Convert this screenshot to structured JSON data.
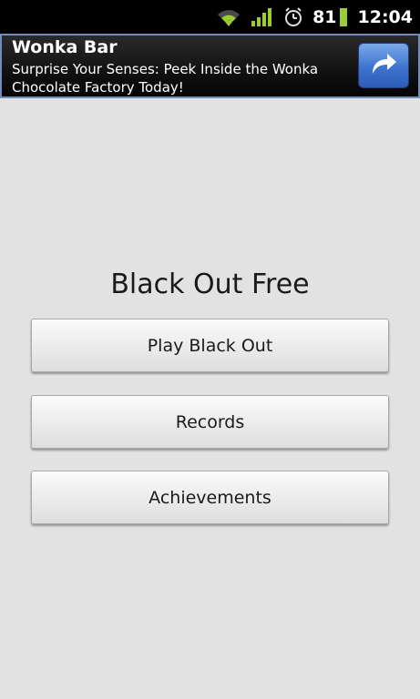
{
  "status_bar": {
    "battery": "81",
    "time": "12:04",
    "icons": [
      "wifi-icon",
      "signal-icon",
      "alarm-icon",
      "battery-icon"
    ]
  },
  "ad": {
    "title": "Wonka Bar",
    "body": "Surprise Your Senses: Peek Inside the Wonka Chocolate Factory Today!",
    "icon": "share-arrow-icon"
  },
  "main": {
    "title": "Black Out Free",
    "buttons": [
      {
        "label": "Play Black Out"
      },
      {
        "label": "Records"
      },
      {
        "label": "Achievements"
      }
    ]
  },
  "colors": {
    "background": "#e2e2e2",
    "ad_border": "#6f8fb8",
    "status_icon_green": "#9acd32"
  }
}
